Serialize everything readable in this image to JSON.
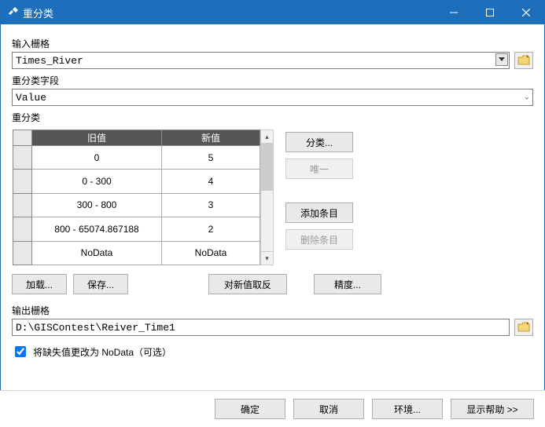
{
  "window": {
    "title": "重分类"
  },
  "labels": {
    "input_raster": "输入栅格",
    "reclass_field": "重分类字段",
    "reclass": "重分类",
    "output_raster": "输出栅格",
    "nodata_checkbox": "将缺失值更改为 NoData（可选）"
  },
  "inputs": {
    "input_raster_value": "Times_River",
    "reclass_field_value": "Value",
    "output_raster_value": "D:\\GISContest\\Reiver_Time1",
    "nodata_checked": true
  },
  "table": {
    "headers": {
      "old": "旧值",
      "new": "新值"
    },
    "rows": [
      {
        "old": "0",
        "new": "5"
      },
      {
        "old": "0 - 300",
        "new": "4"
      },
      {
        "old": "300 - 800",
        "new": "3"
      },
      {
        "old": "800 - 65074.867188",
        "new": "2"
      },
      {
        "old": "NoData",
        "new": "NoData"
      }
    ]
  },
  "side_buttons": {
    "classify": "分类...",
    "unique": "唯一",
    "add_entry": "添加条目",
    "delete_entry": "删除条目"
  },
  "under_buttons": {
    "load": "加载...",
    "save": "保存...",
    "invert": "对新值取反",
    "precision": "精度..."
  },
  "bottom_buttons": {
    "ok": "确定",
    "cancel": "取消",
    "env": "环境...",
    "help": "显示帮助 >>"
  }
}
